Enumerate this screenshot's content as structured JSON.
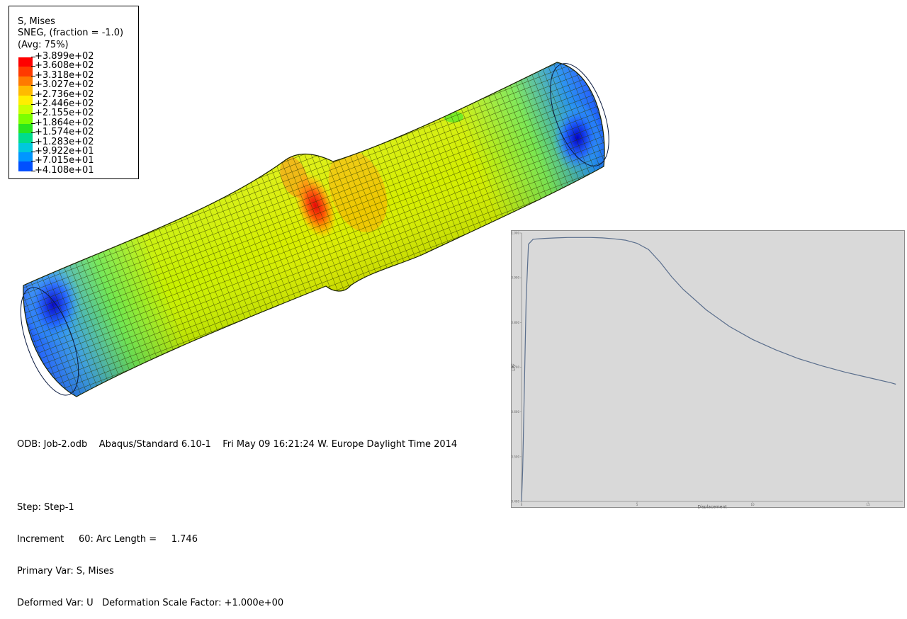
{
  "legend": {
    "title_line1": "S, Mises",
    "title_line2": "SNEG, (fraction = -1.0)",
    "title_line3": "(Avg: 75%)",
    "values": [
      "+3.899e+02",
      "+3.608e+02",
      "+3.318e+02",
      "+3.027e+02",
      "+2.736e+02",
      "+2.446e+02",
      "+2.155e+02",
      "+1.864e+02",
      "+1.574e+02",
      "+1.283e+02",
      "+9.922e+01",
      "+7.015e+01",
      "+4.108e+01"
    ],
    "colors": [
      "#ff0000",
      "#ff3a00",
      "#ff7a00",
      "#ffba00",
      "#ffee00",
      "#c8ff00",
      "#7bff00",
      "#28e61e",
      "#00dc8c",
      "#00c8dc",
      "#0096ff",
      "#0050ff",
      "#0000ff"
    ]
  },
  "info": {
    "line1": "ODB: Job-2.odb    Abaqus/Standard 6.10-1    Fri May 09 16:21:24 W. Europe Daylight Time 2014",
    "line2": "Step: Step-1",
    "line3": "Increment     60: Arc Length =     1.746",
    "line4": "Primary Var: S, Mises",
    "line5": "Deformed Var: U   Deformation Scale Factor: +1.000e+00"
  },
  "chart_data": {
    "type": "line",
    "title": "",
    "xlabel": "Displacement",
    "ylabel": "LPF",
    "xlim": [
      0,
      16.5
    ],
    "ylim": [
      0.4,
      1.0
    ],
    "x_ticks": [
      "0",
      "5",
      "10",
      "15"
    ],
    "y_ticks": [
      "0.400",
      "0.500",
      "0.600",
      "0.700",
      "0.800",
      "0.900",
      "1.000"
    ],
    "grid": false,
    "background": "#d9d9d9",
    "line_color": "#5a6e8c",
    "series": [
      {
        "x": [
          0.0,
          0.05,
          0.1,
          0.2,
          0.3,
          0.5,
          1.0,
          1.5,
          2.0,
          2.5,
          3.0,
          3.5,
          4.0,
          4.5,
          5.0,
          5.5,
          6.0,
          6.5,
          7.0,
          8.0,
          9.0,
          10.0,
          11.0,
          12.0,
          13.0,
          14.0,
          15.0,
          16.0,
          16.2
        ],
        "y": [
          0.4,
          0.47,
          0.6,
          0.85,
          0.975,
          0.986,
          0.988,
          0.989,
          0.99,
          0.99,
          0.99,
          0.989,
          0.987,
          0.984,
          0.977,
          0.963,
          0.935,
          0.902,
          0.874,
          0.828,
          0.791,
          0.762,
          0.739,
          0.719,
          0.703,
          0.689,
          0.677,
          0.665,
          0.662
        ]
      }
    ]
  }
}
